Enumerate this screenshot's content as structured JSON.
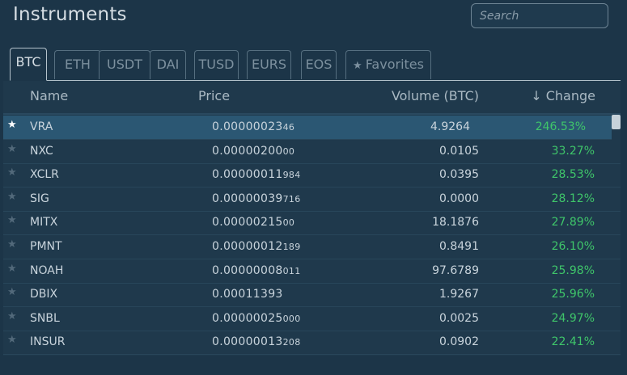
{
  "title": "Instruments",
  "search": {
    "placeholder": "Search"
  },
  "tabs": [
    {
      "label": "BTC",
      "active": true
    },
    {
      "label": "ETH"
    },
    {
      "label": "USDT"
    },
    {
      "label": "DAI"
    },
    {
      "label": "TUSD"
    },
    {
      "label": "EURS"
    },
    {
      "label": "EOS"
    },
    {
      "label": "Favorites",
      "icon": "star-icon"
    }
  ],
  "columns": {
    "name": "Name",
    "price": "Price",
    "volume": "Volume (BTC)",
    "change": "Change",
    "change_sort_icon": "arrow-down-icon"
  },
  "rows": [
    {
      "name": "VRA",
      "price_main": "0.00000023",
      "price_small": "46",
      "volume": "4.9264",
      "change": "246.53%",
      "selected": true
    },
    {
      "name": "NXC",
      "price_main": "0.00000200",
      "price_small": "00",
      "volume": "0.0105",
      "change": "33.27%"
    },
    {
      "name": "XCLR",
      "price_main": "0.00000011",
      "price_small": "984",
      "volume": "0.0395",
      "change": "28.53%"
    },
    {
      "name": "SIG",
      "price_main": "0.00000039",
      "price_small": "716",
      "volume": "0.0000",
      "change": "28.12%"
    },
    {
      "name": "MITX",
      "price_main": "0.00000215",
      "price_small": "00",
      "volume": "18.1876",
      "change": "27.89%"
    },
    {
      "name": "PMNT",
      "price_main": "0.00000012",
      "price_small": "189",
      "volume": "0.8491",
      "change": "26.10%"
    },
    {
      "name": "NOAH",
      "price_main": "0.00000008",
      "price_small": "011",
      "volume": "97.6789",
      "change": "25.98%"
    },
    {
      "name": "DBIX",
      "price_main": "0.00011393",
      "price_small": "",
      "volume": "1.9267",
      "change": "25.96%"
    },
    {
      "name": "SNBL",
      "price_main": "0.00000025",
      "price_small": "000",
      "volume": "0.0025",
      "change": "24.97%"
    },
    {
      "name": "INSUR",
      "price_main": "0.00000013",
      "price_small": "208",
      "volume": "0.0902",
      "change": "22.41%"
    }
  ],
  "colors": {
    "positive": "#3fc66a",
    "selected_row": "#2b5773",
    "background": "#1c3548"
  }
}
